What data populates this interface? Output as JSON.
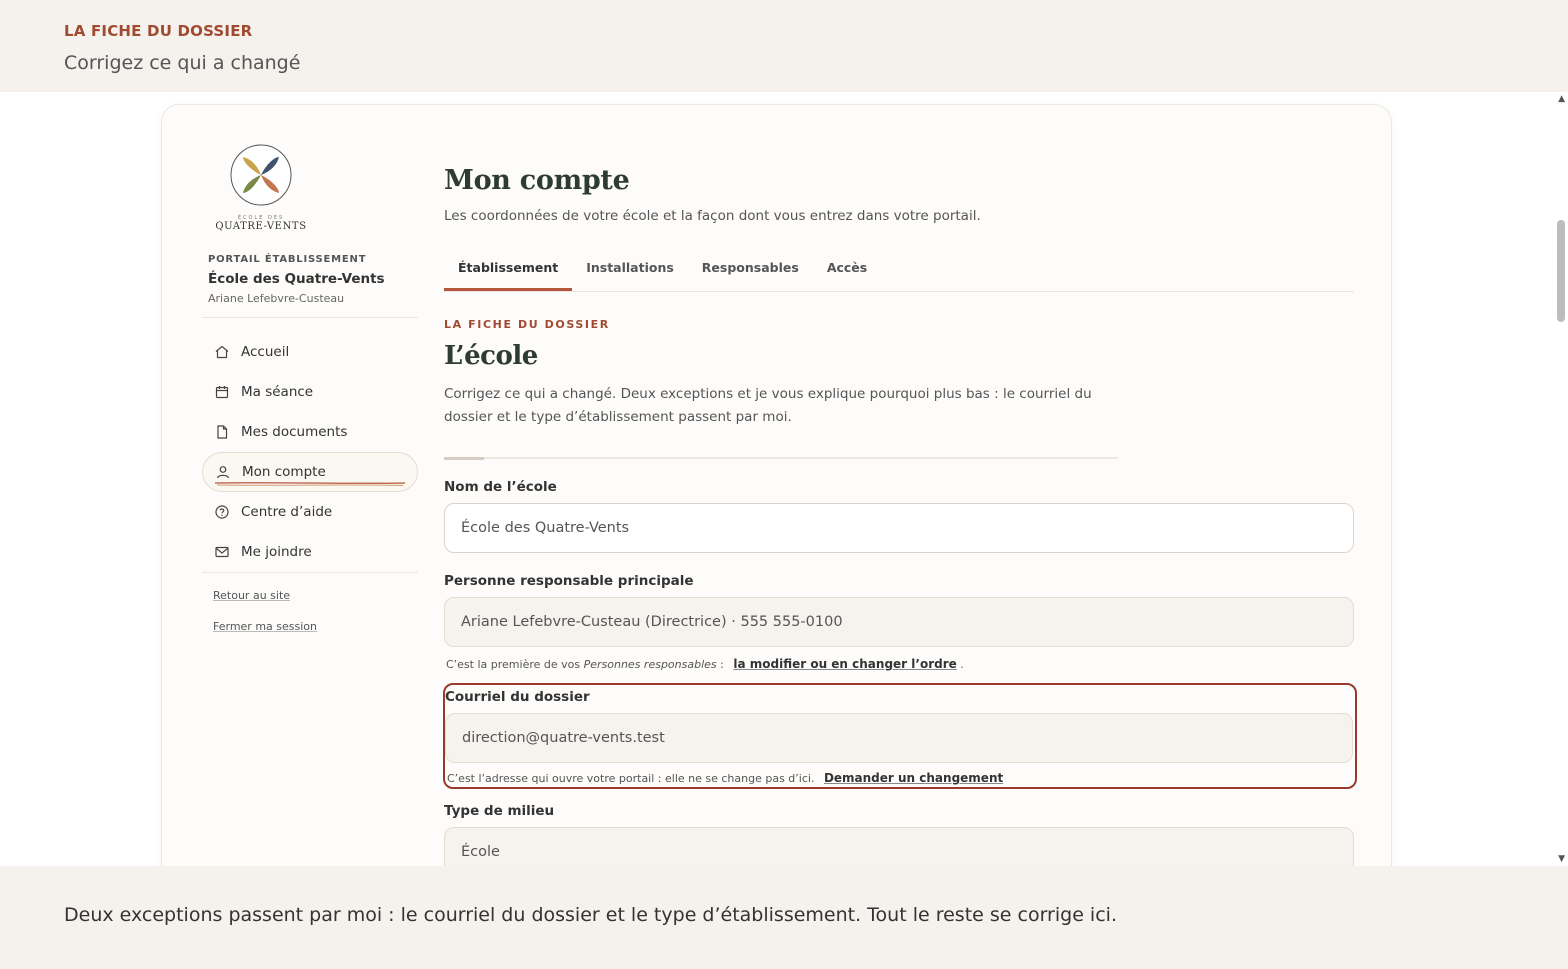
{
  "top_banner": {
    "eyebrow": "LA FICHE DU DOSSIER",
    "subtitle": "Corrigez ce qui a changé"
  },
  "sidebar": {
    "logo": {
      "small": "ÉCOLE DES",
      "name": "QUATRE-VENTS"
    },
    "portal_label": "PORTAIL ÉTABLISSEMENT",
    "school_name": "École des Quatre-Vents",
    "user_name": "Ariane Lefebvre-Custeau",
    "nav": [
      {
        "label": "Accueil",
        "icon": "home-icon"
      },
      {
        "label": "Ma séance",
        "icon": "calendar-icon"
      },
      {
        "label": "Mes documents",
        "icon": "document-icon"
      },
      {
        "label": "Mon compte",
        "icon": "user-icon",
        "active": true
      },
      {
        "label": "Centre d’aide",
        "icon": "help-icon"
      },
      {
        "label": "Me joindre",
        "icon": "mail-icon"
      }
    ],
    "links": [
      "Retour au site",
      "Fermer ma session"
    ]
  },
  "main": {
    "title": "Mon compte",
    "subtitle": "Les coordonnées de votre école et la façon dont vous entrez dans votre portail.",
    "tabs": [
      "Établissement",
      "Installations",
      "Responsables",
      "Accès"
    ],
    "active_tab": 0,
    "eyebrow": "LA FICHE DU DOSSIER",
    "section_title": "L’école",
    "section_desc": "Corrigez ce qui a changé. Deux exceptions et je vous explique pourquoi plus bas : le courriel du dossier et le type d’établissement passent par moi.",
    "fields": {
      "school_name": {
        "label": "Nom de l’école",
        "value": "École des Quatre-Vents"
      },
      "main_contact": {
        "label": "Personne responsable principale",
        "value": "Ariane Lefebvre-Custeau (Directrice) · 555 555-0100",
        "hint_prefix": "C’est la première de vos ",
        "hint_em": "Personnes responsables",
        "hint_sep": " :",
        "hint_link": "la modifier ou en changer l’ordre",
        "hint_end": "."
      },
      "email": {
        "label": "Courriel du dossier",
        "value": "direction@quatre-vents.test",
        "hint": "C’est l’adresse qui ouvre votre portail : elle ne se change pas d’ici.",
        "hint_link": "Demander un changement"
      },
      "type": {
        "label": "Type de milieu",
        "value": "École"
      }
    }
  },
  "bottom_banner": {
    "text": "Deux exceptions passent par moi : le courriel du dossier et le type d’établissement. Tout le reste se corrige ici."
  },
  "colors": {
    "accent": "#a04a32",
    "highlight_border": "#9a3a2c",
    "title_green": "#2e3b33",
    "background": "#f5f1ec"
  }
}
